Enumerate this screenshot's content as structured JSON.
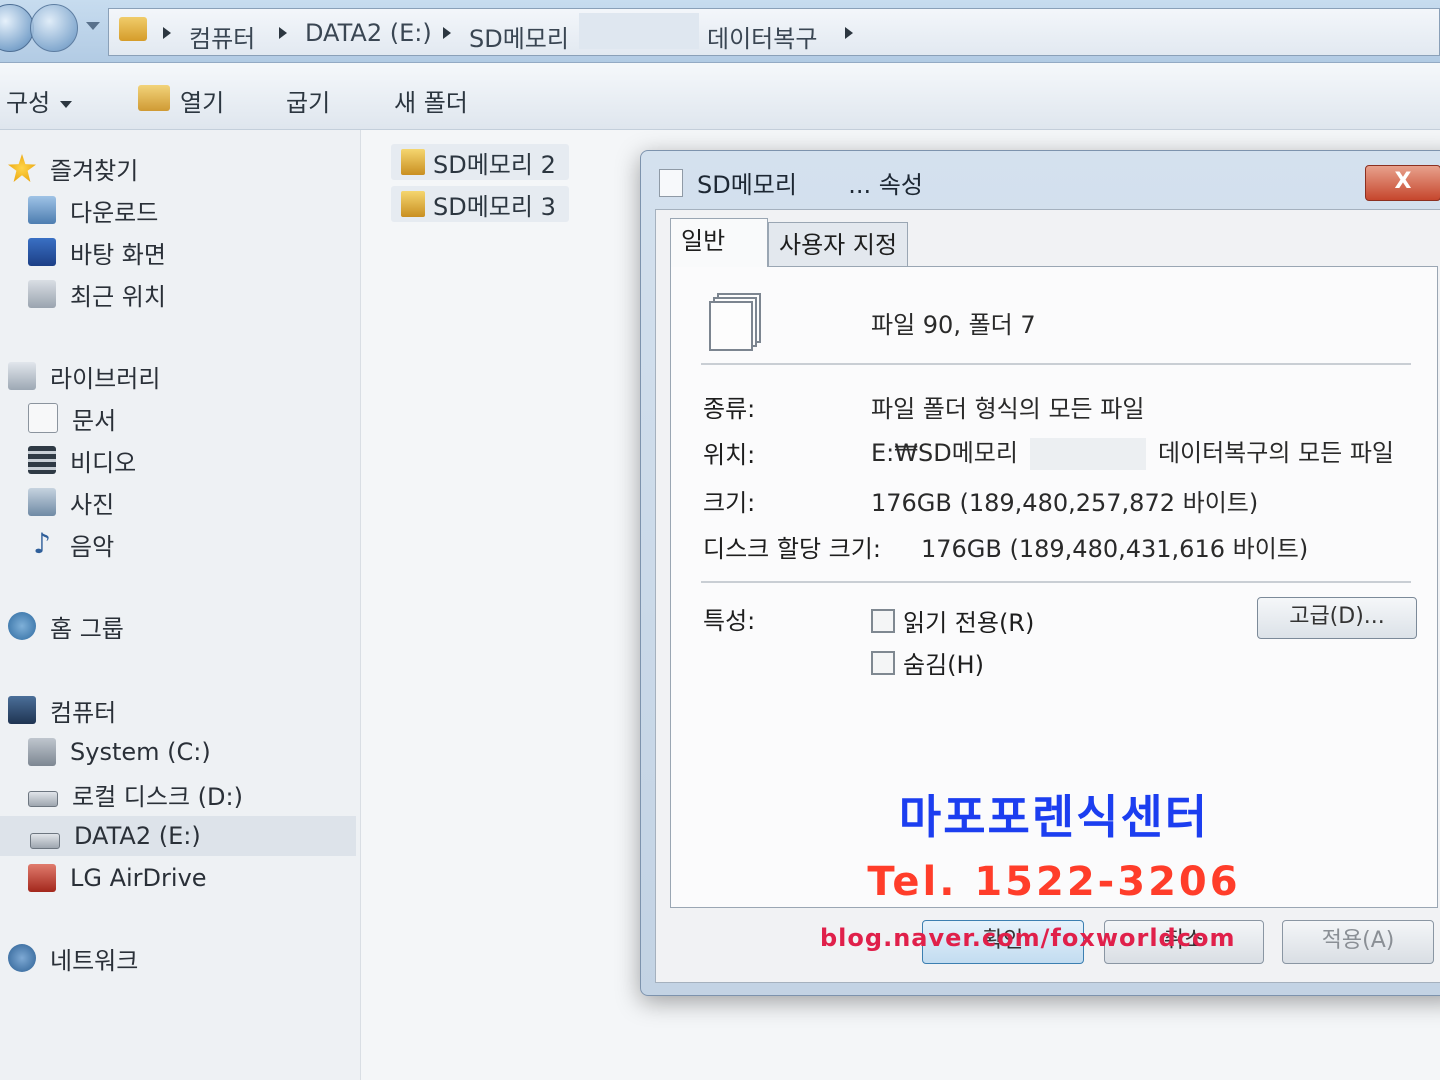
{
  "breadcrumb": {
    "items": [
      "컴퓨터",
      "DATA2 (E:)",
      "SD메모리",
      "데이터복구"
    ]
  },
  "toolbar": {
    "organize": "구성",
    "open": "열기",
    "burn": "굽기",
    "new_folder": "새 폴더"
  },
  "sidebar": {
    "favorites": "즐겨찾기",
    "downloads": "다운로드",
    "desktop": "바탕 화면",
    "recent": "최근 위치",
    "libraries": "라이브러리",
    "documents": "문서",
    "videos": "비디오",
    "pictures": "사진",
    "music": "음악",
    "homegroup": "홈 그룹",
    "computer": "컴퓨터",
    "drive_c": "System (C:)",
    "drive_d": "로컬 디스크 (D:)",
    "drive_e": "DATA2 (E:)",
    "airdrive": "LG AirDrive",
    "network": "네트워크"
  },
  "files": [
    "SD메모리 2",
    "SD메모리 3"
  ],
  "dialog": {
    "title_prefix": "SD메모리",
    "title_suffix": "... 속성",
    "close": "X",
    "tabs": [
      "일반",
      "사용자 지정"
    ],
    "summary": "파일 90, 폴더 7",
    "type_label": "종류:",
    "type_value": "파일 폴더 형식의 모든 파일",
    "location_label": "위치:",
    "location_prefix": "E:₩SD메모리",
    "location_suffix": "데이터복구의 모든 파일",
    "size_label": "크기:",
    "size_value": "176GB (189,480,257,872 바이트)",
    "disk_label": "디스크 할당 크기:",
    "disk_value": "176GB (189,480,431,616 바이트)",
    "attributes_label": "특성:",
    "readonly": "읽기 전용(R)",
    "hidden": "숨김(H)",
    "advanced": "고급(D)...",
    "ok": "확인",
    "cancel": "취소",
    "apply": "적용(A)"
  },
  "watermark": {
    "name": "마포포렌식센터",
    "tel": "Tel. 1522-3206",
    "blog": "blog.naver.com/foxworldcom"
  },
  "colors": {
    "watermark_blue": "#1c3ef0",
    "watermark_red": "#ff3d2a",
    "watermark_pink": "#e0204a"
  }
}
